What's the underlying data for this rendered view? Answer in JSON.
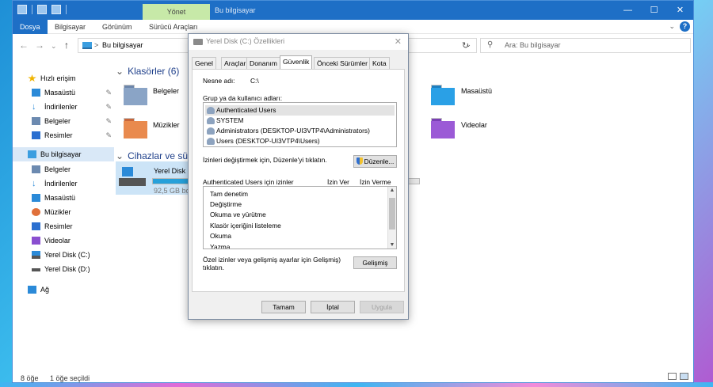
{
  "explorer": {
    "title": "Bu bilgisayar",
    "manage_tab": "Yönet",
    "ribbon_tabs": [
      "Dosya",
      "Bilgisayar",
      "Görünüm",
      "Sürücü Araçları"
    ],
    "address": "Bu bilgisayar",
    "address_sep": ">",
    "search_placeholder": "Ara: Bu bilgisayar",
    "sidebar": [
      {
        "label": "Hızlı erişim",
        "icon": "star-icon",
        "color": "#f0b400"
      },
      {
        "label": "Masaüstü",
        "icon": "desktop-icon",
        "color": "#2b8ad8",
        "pinned": true
      },
      {
        "label": "İndirilenler",
        "icon": "download-icon",
        "color": "#2b8ad8",
        "pinned": true
      },
      {
        "label": "Belgeler",
        "icon": "documents-icon",
        "color": "#6c8ab0",
        "pinned": true
      },
      {
        "label": "Resimler",
        "icon": "pictures-icon",
        "color": "#2b6fd0",
        "pinned": true
      },
      {
        "label": "Bu bilgisayar",
        "icon": "computer-icon",
        "color": "#3b9ee0"
      },
      {
        "label": "Belgeler",
        "icon": "documents-icon",
        "color": "#6c8ab0"
      },
      {
        "label": "İndirilenler",
        "icon": "download-icon",
        "color": "#2b8ad8"
      },
      {
        "label": "Masaüstü",
        "icon": "desktop-icon",
        "color": "#2b8ad8"
      },
      {
        "label": "Müzikler",
        "icon": "music-icon",
        "color": "#e0703a"
      },
      {
        "label": "Resimler",
        "icon": "pictures-icon",
        "color": "#2b6fd0"
      },
      {
        "label": "Videolar",
        "icon": "videos-icon",
        "color": "#8a4fd0"
      },
      {
        "label": "Yerel Disk (C:)",
        "icon": "windows-drive-icon",
        "color": "#2b8ad8"
      },
      {
        "label": "Yerel Disk (D:)",
        "icon": "drive-icon",
        "color": "#555555"
      },
      {
        "label": "Ağ",
        "icon": "network-icon",
        "color": "#2b8ad8"
      }
    ],
    "folders_header": "Klasörler (6)",
    "folders": [
      {
        "label": "Belgeler",
        "color": "#8aa4c6"
      },
      {
        "label": "Müzikler",
        "color": "#e98a4e"
      },
      {
        "label": "Masaüstü",
        "color": "#2aa0e6"
      },
      {
        "label": "Videolar",
        "color": "#9b5ad6"
      }
    ],
    "devices_header": "Cihazlar ve sürüc",
    "drive": {
      "name": "Yerel Disk (",
      "free": "92,5 GB boş",
      "used_fraction": 0.18
    },
    "status": {
      "count": "8 öğe",
      "selected": "1 öğe seçildi"
    }
  },
  "dialog": {
    "title": "Yerel Disk (C:) Özellikleri",
    "tabs": [
      "Genel",
      "Araçlar",
      "Donanım",
      "Güvenlik",
      "Önceki Sürümler",
      "Kota"
    ],
    "active_tab": "Güvenlik",
    "object_label": "Nesne adı:",
    "object_value": "C:\\",
    "group_label": "Grup ya da kullanıcı adları:",
    "users": [
      "Authenticated Users",
      "SYSTEM",
      "Administrators (DESKTOP-UI3VTP4\\Administrators)",
      "Users (DESKTOP-UI3VTP4\\Users)"
    ],
    "edit_hint": "İzinleri değiştirmek için, Düzenle'yi tıklatın.",
    "edit_button": "Düzenle...",
    "perm_header": "Authenticated Users için izinler",
    "allow_col": "İzin Ver",
    "deny_col": "İzin Verme",
    "permissions": [
      "Tam denetim",
      "Değiştirme",
      "Okuma ve yürütme",
      "Klasör içeriğini listeleme",
      "Okuma",
      "Yazma"
    ],
    "advanced_hint_1": "Özel izinler veya gelişmiş ayarlar için Gelişmiş)",
    "advanced_hint_2": "tıklatın.",
    "advanced_button": "Gelişmiş",
    "ok": "Tamam",
    "cancel": "İptal",
    "apply": "Uygula"
  }
}
